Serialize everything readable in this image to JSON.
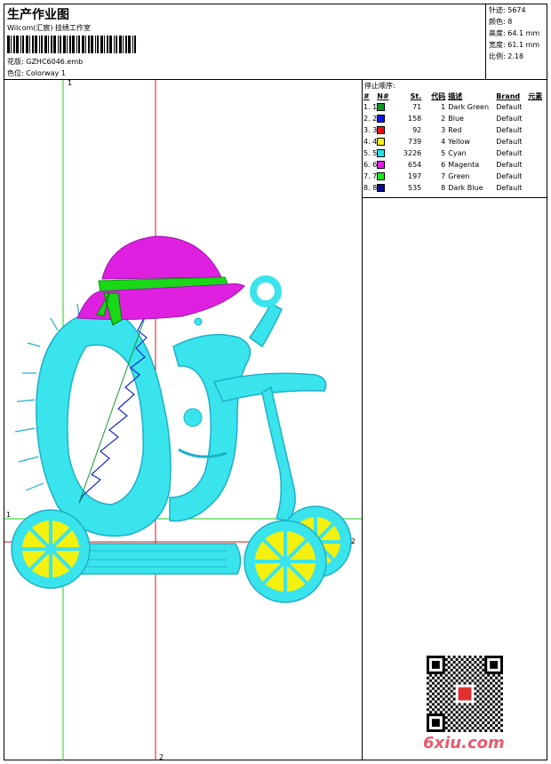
{
  "header": {
    "title": "生产作业图",
    "company": "Wilcom(汇宸) 技绣工作室",
    "design_label": "花版:",
    "design_value": "GZHC6046.emb",
    "colorway_label": "色位:",
    "colorway_value": "Colorway 1"
  },
  "stats": {
    "stitches": "针迹: 5674",
    "colors": "颜色: 8",
    "height": "高度: 64.1 mm",
    "width": "宽度: 61.1 mm",
    "scale": "比例: 2.18"
  },
  "legend": {
    "title": "停止顺序:",
    "headers": [
      "#",
      "N#",
      "St.",
      "代码",
      "描述",
      "Brand",
      "元素"
    ],
    "rows": [
      {
        "idx": "1. 1",
        "color": "#109a2c",
        "st": "71",
        "code": "1",
        "desc": "Dark Green",
        "brand": "Default"
      },
      {
        "idx": "2. 2",
        "color": "#0a18e8",
        "st": "158",
        "code": "2",
        "desc": "Blue",
        "brand": "Default"
      },
      {
        "idx": "3. 3",
        "color": "#e81010",
        "st": "92",
        "code": "3",
        "desc": "Red",
        "brand": "Default"
      },
      {
        "idx": "4. 4",
        "color": "#f4f010",
        "st": "739",
        "code": "4",
        "desc": "Yellow",
        "brand": "Default"
      },
      {
        "idx": "5. 5",
        "color": "#22e6e6",
        "st": "3226",
        "code": "5",
        "desc": "Cyan",
        "brand": "Default"
      },
      {
        "idx": "6. 6",
        "color": "#e81ee8",
        "st": "654",
        "code": "6",
        "desc": "Magenta",
        "brand": "Default"
      },
      {
        "idx": "7. 7",
        "color": "#18e818",
        "st": "197",
        "code": "7",
        "desc": "Green",
        "brand": "Default"
      },
      {
        "idx": "8. 8",
        "color": "#0a0a90",
        "st": "535",
        "code": "8",
        "desc": "Dark Blue",
        "brand": "Default"
      }
    ]
  },
  "guides": {
    "v1": "1",
    "v2": "2",
    "h1": "1",
    "h2": "2"
  },
  "watermark": "6xiu.com"
}
